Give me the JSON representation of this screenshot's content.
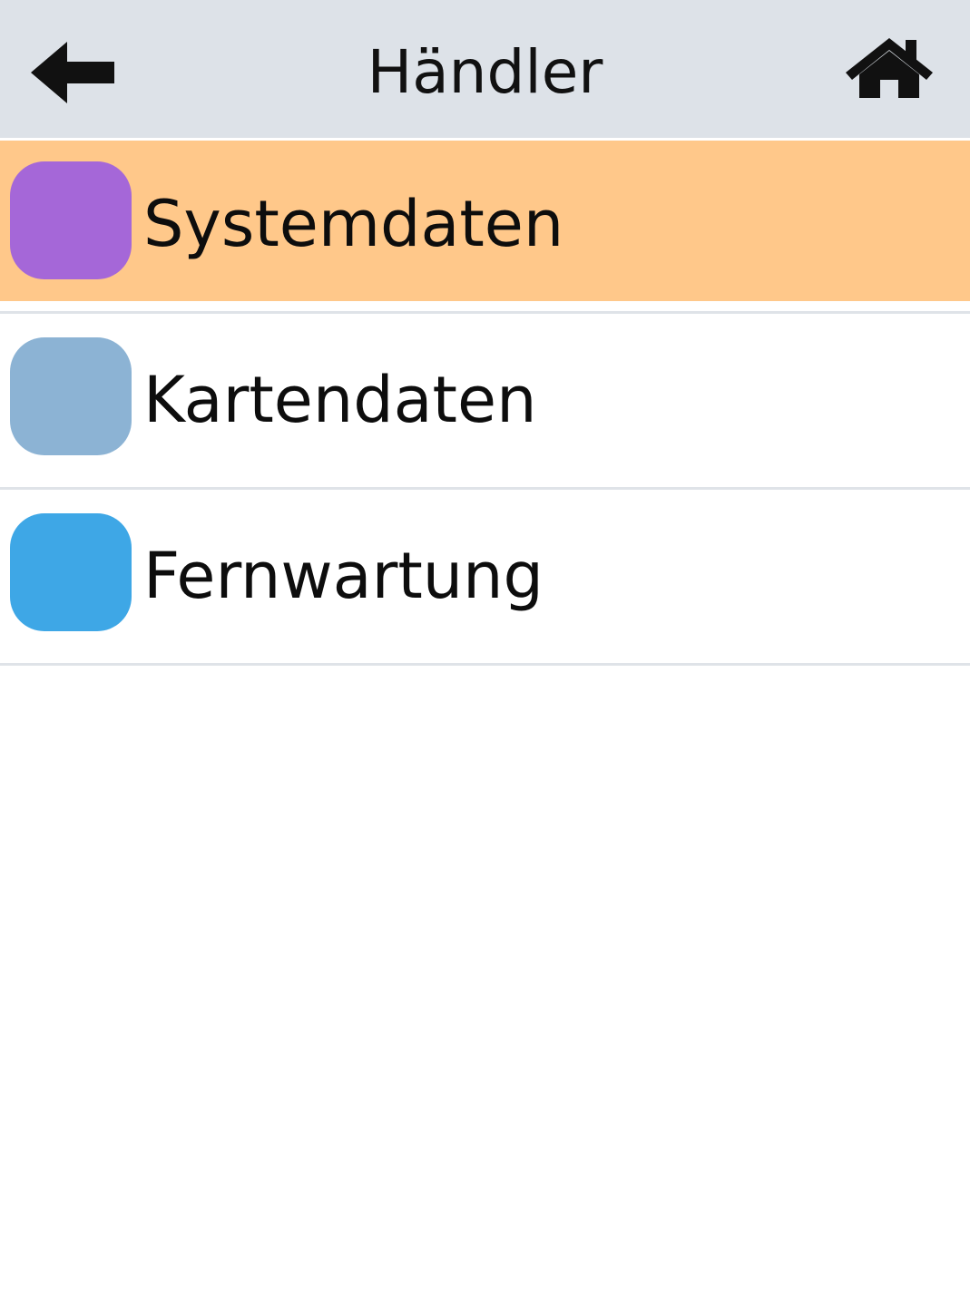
{
  "header": {
    "title": "Händler",
    "back_icon": "arrow-left-icon",
    "home_icon": "home-icon"
  },
  "menu": {
    "items": [
      {
        "label": "Systemdaten",
        "color": "#a567d8",
        "selected": true
      },
      {
        "label": "Kartendaten",
        "color": "#8cb3d4",
        "selected": false
      },
      {
        "label": "Fernwartung",
        "color": "#3ea7e6",
        "selected": false
      }
    ]
  },
  "colors": {
    "header_bg": "#dde2e8",
    "selected_bg": "#ffc88a",
    "divider": "#dfe3e8"
  }
}
